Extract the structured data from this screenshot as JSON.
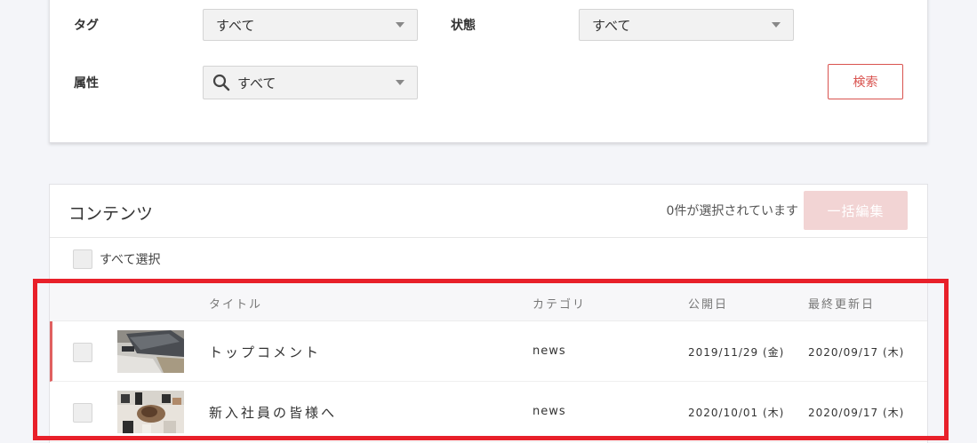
{
  "filters": {
    "tag_label": "タグ",
    "tag_value": "すべて",
    "status_label": "状態",
    "status_value": "すべて",
    "attribute_label": "属性",
    "attribute_value": "すべて",
    "search_button": "検索"
  },
  "contents": {
    "title": "コンテンツ",
    "selected_count": "0件が選択されています",
    "bulk_edit_button": "一括編集",
    "select_all_label": "すべて選択",
    "columns": {
      "title": "タイトル",
      "category": "カテゴリ",
      "published": "公開日",
      "updated": "最終更新日"
    },
    "rows": [
      {
        "title": "トップコメント",
        "category": "news",
        "published": "2019/11/29 (金)",
        "updated": "2020/09/17 (木)"
      },
      {
        "title": "新入社員の皆様へ",
        "category": "news",
        "published": "2020/10/01 (木)",
        "updated": "2020/09/17 (木)"
      }
    ]
  },
  "colors": {
    "accent": "#d9534f",
    "highlight": "#e8202a",
    "bulk_disabled": "#f2d4d4"
  },
  "icons": [
    "chevron-down-icon",
    "search-icon",
    "checkbox-icon"
  ]
}
